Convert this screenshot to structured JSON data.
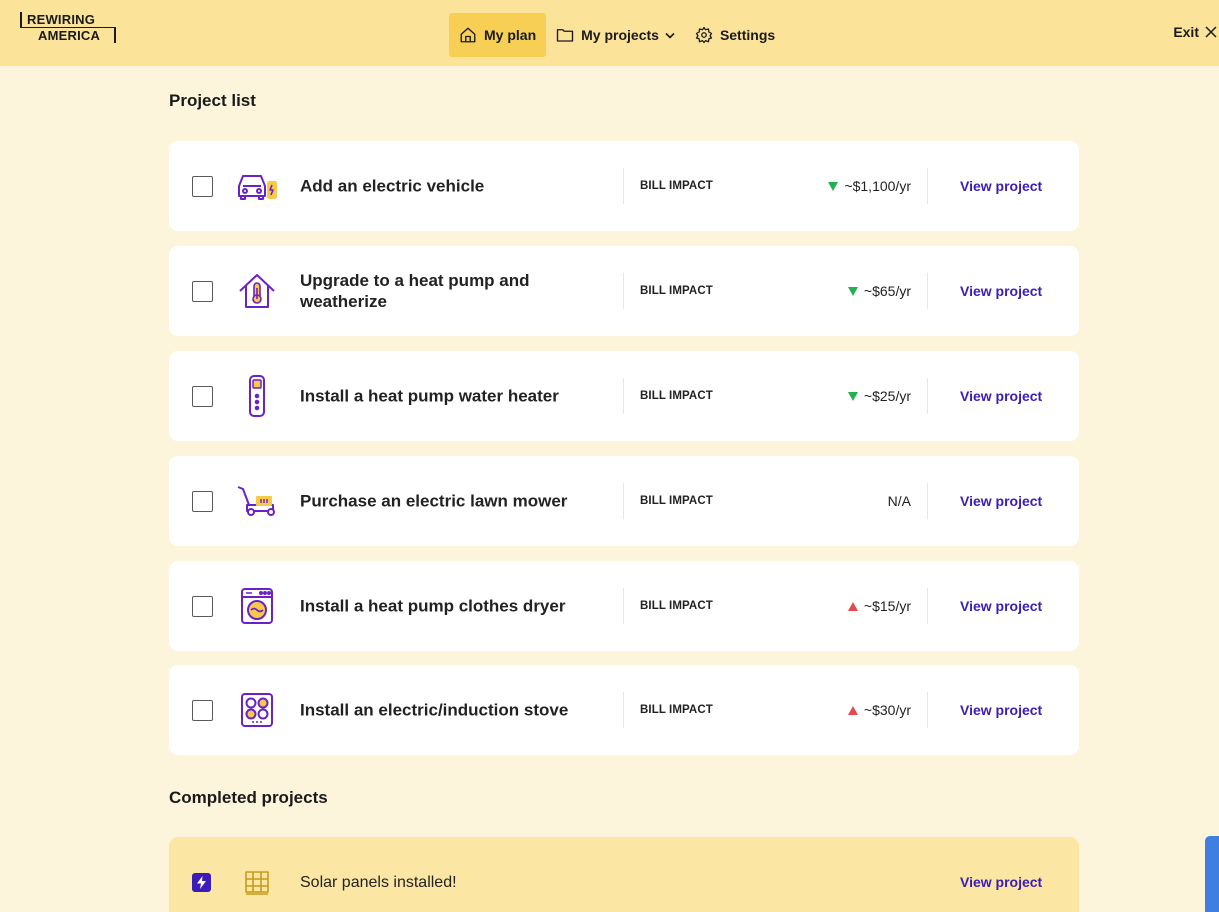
{
  "header": {
    "logo_line1": "REWIRING",
    "logo_line2": "AMERICA",
    "nav": [
      {
        "label": "My plan",
        "icon": "home-icon"
      },
      {
        "label": "My projects",
        "icon": "folder-icon"
      },
      {
        "label": "Settings",
        "icon": "gear-icon"
      }
    ],
    "exit_label": "Exit"
  },
  "project_list": {
    "title": "Project list",
    "impact_label": "BILL IMPACT",
    "view_label": "View project",
    "colors": {
      "decrease": "#23b04f",
      "increase": "#e5484d",
      "link": "#3b1cb8",
      "icon": "#6b21c8",
      "icon_accent": "#f7c948"
    },
    "projects": [
      {
        "title": "Add an electric vehicle",
        "icon": "electric-car-icon",
        "trend": "down",
        "impact": "~$1,100/yr"
      },
      {
        "title": "Upgrade to a heat pump and weatherize",
        "icon": "house-thermometer-icon",
        "trend": "down",
        "impact": "~$65/yr"
      },
      {
        "title": "Install a heat pump water heater",
        "icon": "water-heater-icon",
        "trend": "down",
        "impact": "~$25/yr"
      },
      {
        "title": "Purchase an electric lawn mower",
        "icon": "lawn-mower-icon",
        "trend": "none",
        "impact": "N/A"
      },
      {
        "title": "Install a heat pump clothes dryer",
        "icon": "clothes-dryer-icon",
        "trend": "up",
        "impact": "~$15/yr"
      },
      {
        "title": "Install an electric/induction stove",
        "icon": "induction-stove-icon",
        "trend": "up",
        "impact": "~$30/yr"
      }
    ]
  },
  "completed": {
    "title": "Completed projects",
    "items": [
      {
        "title": "Solar panels installed!",
        "icon": "solar-panel-icon"
      }
    ]
  }
}
